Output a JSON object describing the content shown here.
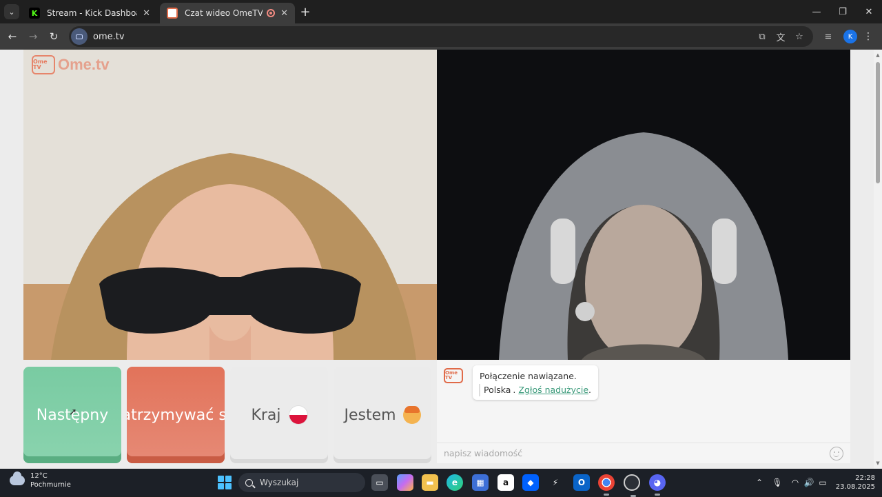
{
  "browser": {
    "tabs": [
      {
        "title": "Stream - Kick Dashboard",
        "favicon": "K",
        "favicon_color": "#53fc18"
      },
      {
        "title": "Czat wideo OmeTV — altern",
        "favicon": "ome",
        "favicon_color": "#e06a48",
        "recording": true
      }
    ],
    "new_tab": "+",
    "url": "ome.tv",
    "profile_initial": "K"
  },
  "page": {
    "logo_tv": "Ome TV",
    "logo_word": "Ome.tv",
    "buttons": {
      "next": "Następny",
      "stop": "Zatrzymywać się",
      "country": "Kraj",
      "gender": "Jestem"
    },
    "chat": {
      "logo": "Ome TV",
      "connected": "Połączenie nawiązane.",
      "country": "Polska",
      "separator": ".",
      "report": "Zgłoś nadużycie",
      "report_end": ".",
      "input_placeholder": "napisz wiadomość"
    }
  },
  "taskbar": {
    "weather_temp": "12°C",
    "weather_desc": "Pochmurnie",
    "search_label": "Wyszukaj",
    "time": "22:28",
    "date": "23.08.2025"
  },
  "colors": {
    "next_green": "#79cba2",
    "stop_red": "#e2735a",
    "accent_link": "#3a9a7a"
  }
}
